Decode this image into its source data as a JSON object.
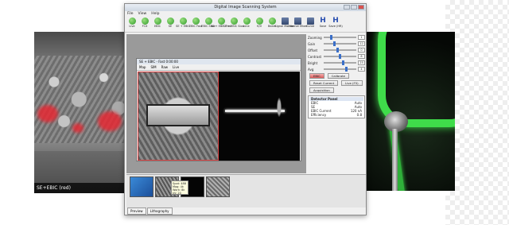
{
  "left_image": {
    "caption": "SE+EBIC (red)"
  },
  "window": {
    "title": "Digital Image Scanning System",
    "menu": [
      "File",
      "View",
      "Help"
    ],
    "toolbar": [
      {
        "label": "Live",
        "icon": "play-icon"
      },
      {
        "label": "FCX",
        "icon": "play-icon"
      },
      {
        "label": "EBIC",
        "icon": "play-icon"
      },
      {
        "label": "SE",
        "icon": "play-icon"
      },
      {
        "label": "SE + EBIC",
        "icon": "play-icon"
      },
      {
        "label": "EBIC Fast",
        "icon": "play-icon"
      },
      {
        "label": "EBIC Slow",
        "icon": "play-icon"
      },
      {
        "label": "SE + EBIC Fast",
        "icon": "play-icon"
      },
      {
        "label": "SE + EBIC Slow",
        "icon": "play-icon"
      },
      {
        "label": "Line",
        "icon": "play-icon"
      },
      {
        "label": "H/V",
        "icon": "play-icon"
      },
      {
        "label": "Beam",
        "icon": "play-icon"
      },
      {
        "label": "Signal Monitor",
        "icon": "monitor-icon"
      },
      {
        "label": "Channel Mixer",
        "icon": "mixer-icon"
      },
      {
        "label": "Curve",
        "icon": "curve-icon"
      },
      {
        "label": "Save",
        "icon": "save-icon"
      },
      {
        "label": "Save (HR)",
        "icon": "save-hr-icon"
      }
    ],
    "image_window": {
      "title": "SE + EBIC - Fast 0:00:00",
      "toolbar": [
        "Map",
        "SIM",
        "Raw",
        "Live"
      ]
    },
    "tooltip": [
      "Spot: 488",
      "Mag: 4k",
      "Work: 8k",
      "kV: 20"
    ],
    "tabs": [
      "Preview",
      "Lithography"
    ],
    "controls": {
      "sliders": [
        {
          "label": "Zooming",
          "value": "1"
        },
        {
          "label": "Gain",
          "value": "12"
        },
        {
          "label": "Offset",
          "value": "0"
        },
        {
          "label": "Contrast",
          "value": "8"
        },
        {
          "label": "Bright",
          "value": "25"
        },
        {
          "label": "Avg",
          "value": "4"
        }
      ],
      "buttons": [
        "EBIC",
        "Calibrate",
        "Reset Current",
        "Live (F5)",
        "Acquisition"
      ],
      "detector_panel": {
        "title": "Detector Panel",
        "rows": [
          {
            "k": "EBIC",
            "v": "Auto"
          },
          {
            "k": "SE",
            "v": "Auto"
          },
          {
            "k": "EBIC Current",
            "v": "120 nA"
          },
          {
            "k": "Efficiency",
            "v": "0.8"
          }
        ]
      }
    }
  }
}
